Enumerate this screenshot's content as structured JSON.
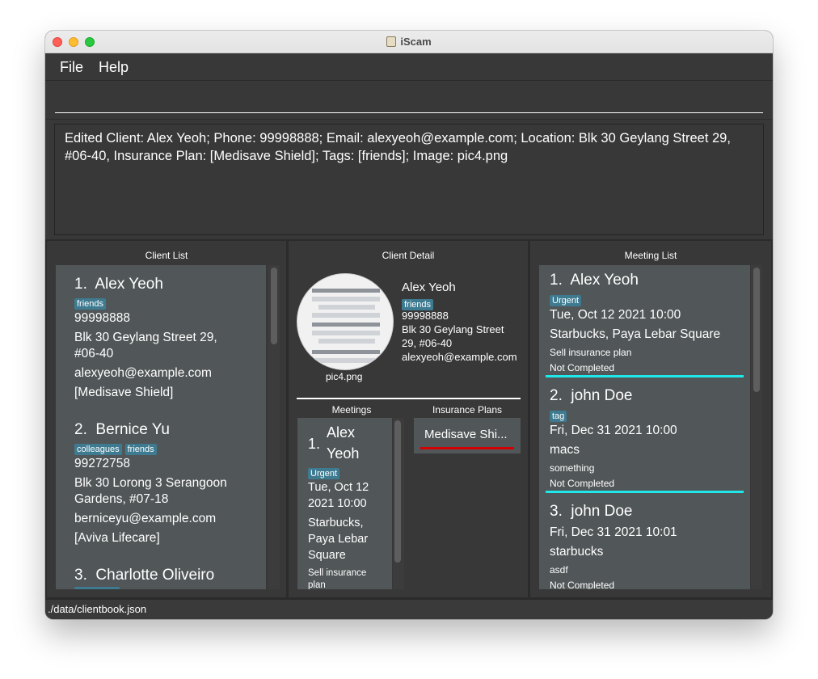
{
  "window": {
    "title": "iScam"
  },
  "menu": {
    "file": "File",
    "help": "Help"
  },
  "command": {
    "value": "",
    "placeholder": ""
  },
  "result": {
    "line1": "Edited Client: Alex Yeoh; Phone: 99998888; Email: alexyeoh@example.com; Location: Blk 30 Geylang Street 29,",
    "line2": "#06-40, Insurance Plan: [Medisave Shield]; Tags: [friends]; Image: pic4.png"
  },
  "client_list": {
    "title": "Client List",
    "items": [
      {
        "index": "1.",
        "name": "Alex Yeoh",
        "tags": [
          "friends"
        ],
        "phone": "99998888",
        "address_l1": "Blk 30 Geylang Street 29,",
        "address_l2": "#06-40",
        "email": "alexyeoh@example.com",
        "plan": "[Medisave Shield]"
      },
      {
        "index": "2.",
        "name": "Bernice Yu",
        "tags": [
          "colleagues",
          "friends"
        ],
        "phone": "99272758",
        "address_l1": "Blk 30 Lorong 3 Serangoon",
        "address_l2": "Gardens, #07-18",
        "email": "berniceyu@example.com",
        "plan": "[Aviva Lifecare]"
      },
      {
        "index": "3.",
        "name": "Charlotte Oliveiro"
      }
    ]
  },
  "client_detail": {
    "title": "Client Detail",
    "name": "Alex Yeoh",
    "tag": "friends",
    "phone": "99998888",
    "address_l1": "Blk 30 Geylang Street",
    "address_l2": "29, #06-40",
    "email": "alexyeoh@example.com",
    "image_name": "pic4.png",
    "meetings_title": "Meetings",
    "plans_title": "Insurance Plans",
    "meeting": {
      "index": "1.",
      "name_l1": "Alex",
      "name_l2": "Yeoh",
      "tag": "Urgent",
      "date_l1": "Tue, Oct 12",
      "date_l2": "2021 10:00",
      "loc_l1": "Starbucks,",
      "loc_l2": "Paya Lebar",
      "loc_l3": "Square",
      "desc_l1": "Sell insurance",
      "desc_l2": "plan"
    },
    "plan_item": "Medisave Shi..."
  },
  "meeting_list": {
    "title": "Meeting List",
    "items": [
      {
        "index": "1.",
        "name": "Alex Yeoh",
        "tag": "Urgent",
        "datetime": "Tue, Oct 12 2021 10:00",
        "location": "Starbucks, Paya Lebar Square",
        "description": "Sell insurance plan",
        "status": "Not Completed"
      },
      {
        "index": "2.",
        "name": "john Doe",
        "tag": "tag",
        "datetime": "Fri, Dec 31 2021 10:00",
        "location": "macs",
        "description": "something",
        "status": "Not Completed"
      },
      {
        "index": "3.",
        "name": "john Doe",
        "datetime": "Fri, Dec 31 2021 10:01",
        "location": "starbucks",
        "description": "asdf",
        "status": "Not Completed"
      }
    ]
  },
  "status_bar": {
    "path": "./data/clientbook.json"
  },
  "colors": {
    "background": "#383838",
    "card": "#515658",
    "tag": "#3e7b91",
    "highlight": "#1fe7ea",
    "plan_underline": "#d20000"
  }
}
